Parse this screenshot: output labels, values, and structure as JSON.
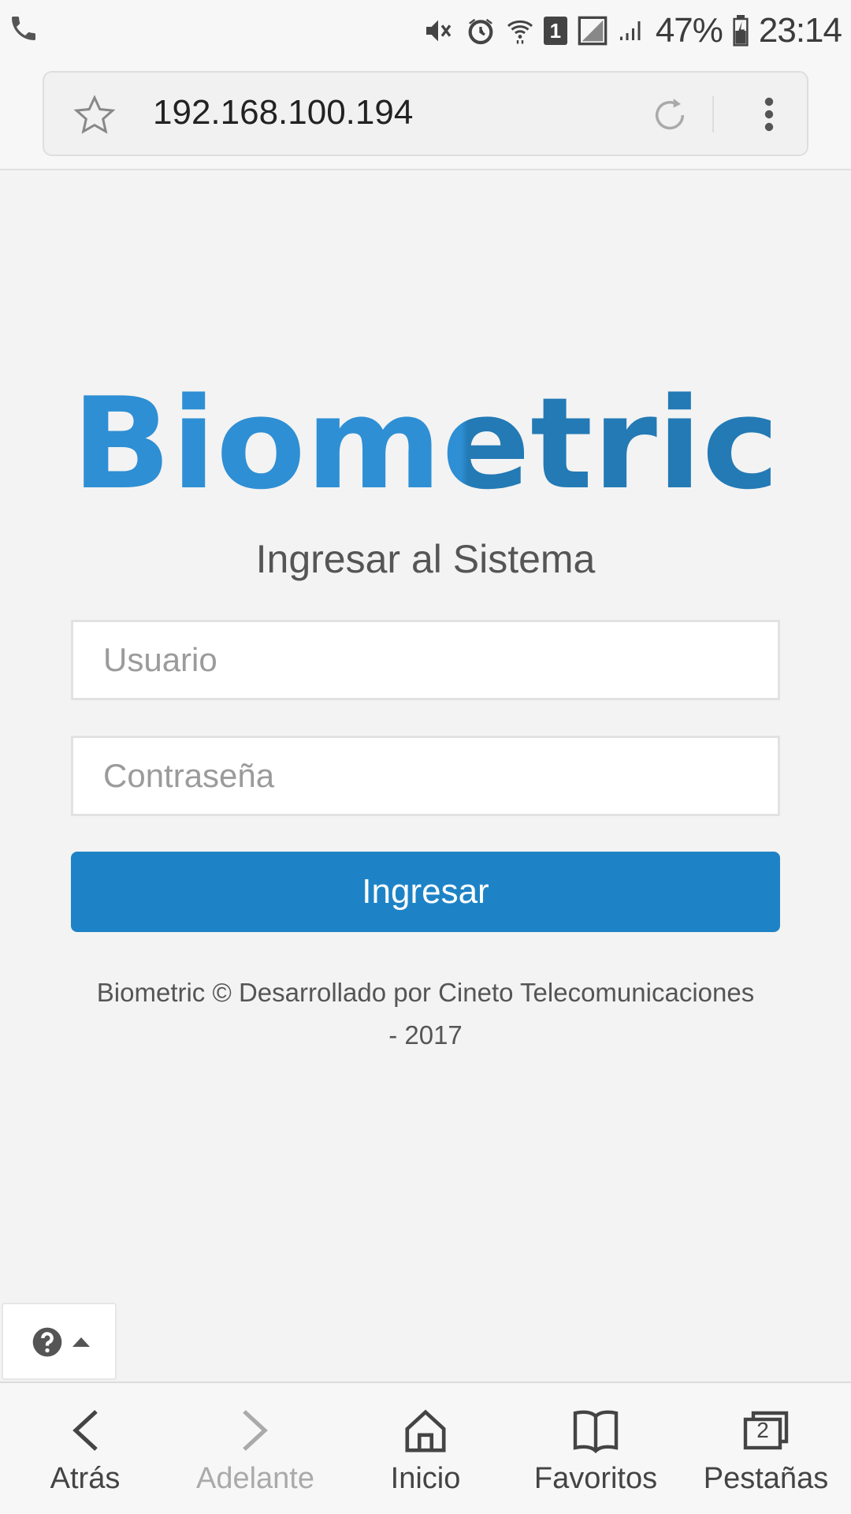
{
  "status_bar": {
    "battery": "47%",
    "time": "23:14",
    "sim_badge": "1",
    "icons": [
      "phone-icon",
      "mute-icon",
      "alarm-icon",
      "wifi-icon",
      "sim-icon",
      "signal-icon",
      "battery-icon"
    ]
  },
  "browser": {
    "url": "192.168.100.194",
    "icons": [
      "star-icon",
      "reload-icon",
      "menu-icon"
    ]
  },
  "page": {
    "logo_text": "Biometric",
    "title": "Ingresar al Sistema",
    "username_placeholder": "Usuario",
    "password_placeholder": "Contraseña",
    "submit_label": "Ingresar",
    "footer_line1": "Biometric © Desarrollado por Cineto Telecomunicaciones",
    "footer_line2": "- 2017",
    "colors": {
      "brand_blue": "#1e83c6",
      "logo_light": "#2e8fd4",
      "logo_dark": "#237ab5"
    }
  },
  "help_widget": {
    "icons": [
      "help-icon",
      "caret-up-icon"
    ]
  },
  "bottom_nav": {
    "back": "Atrás",
    "forward": "Adelante",
    "home": "Inicio",
    "bookmarks": "Favoritos",
    "tabs": "Pestañas",
    "tab_count": "2"
  }
}
